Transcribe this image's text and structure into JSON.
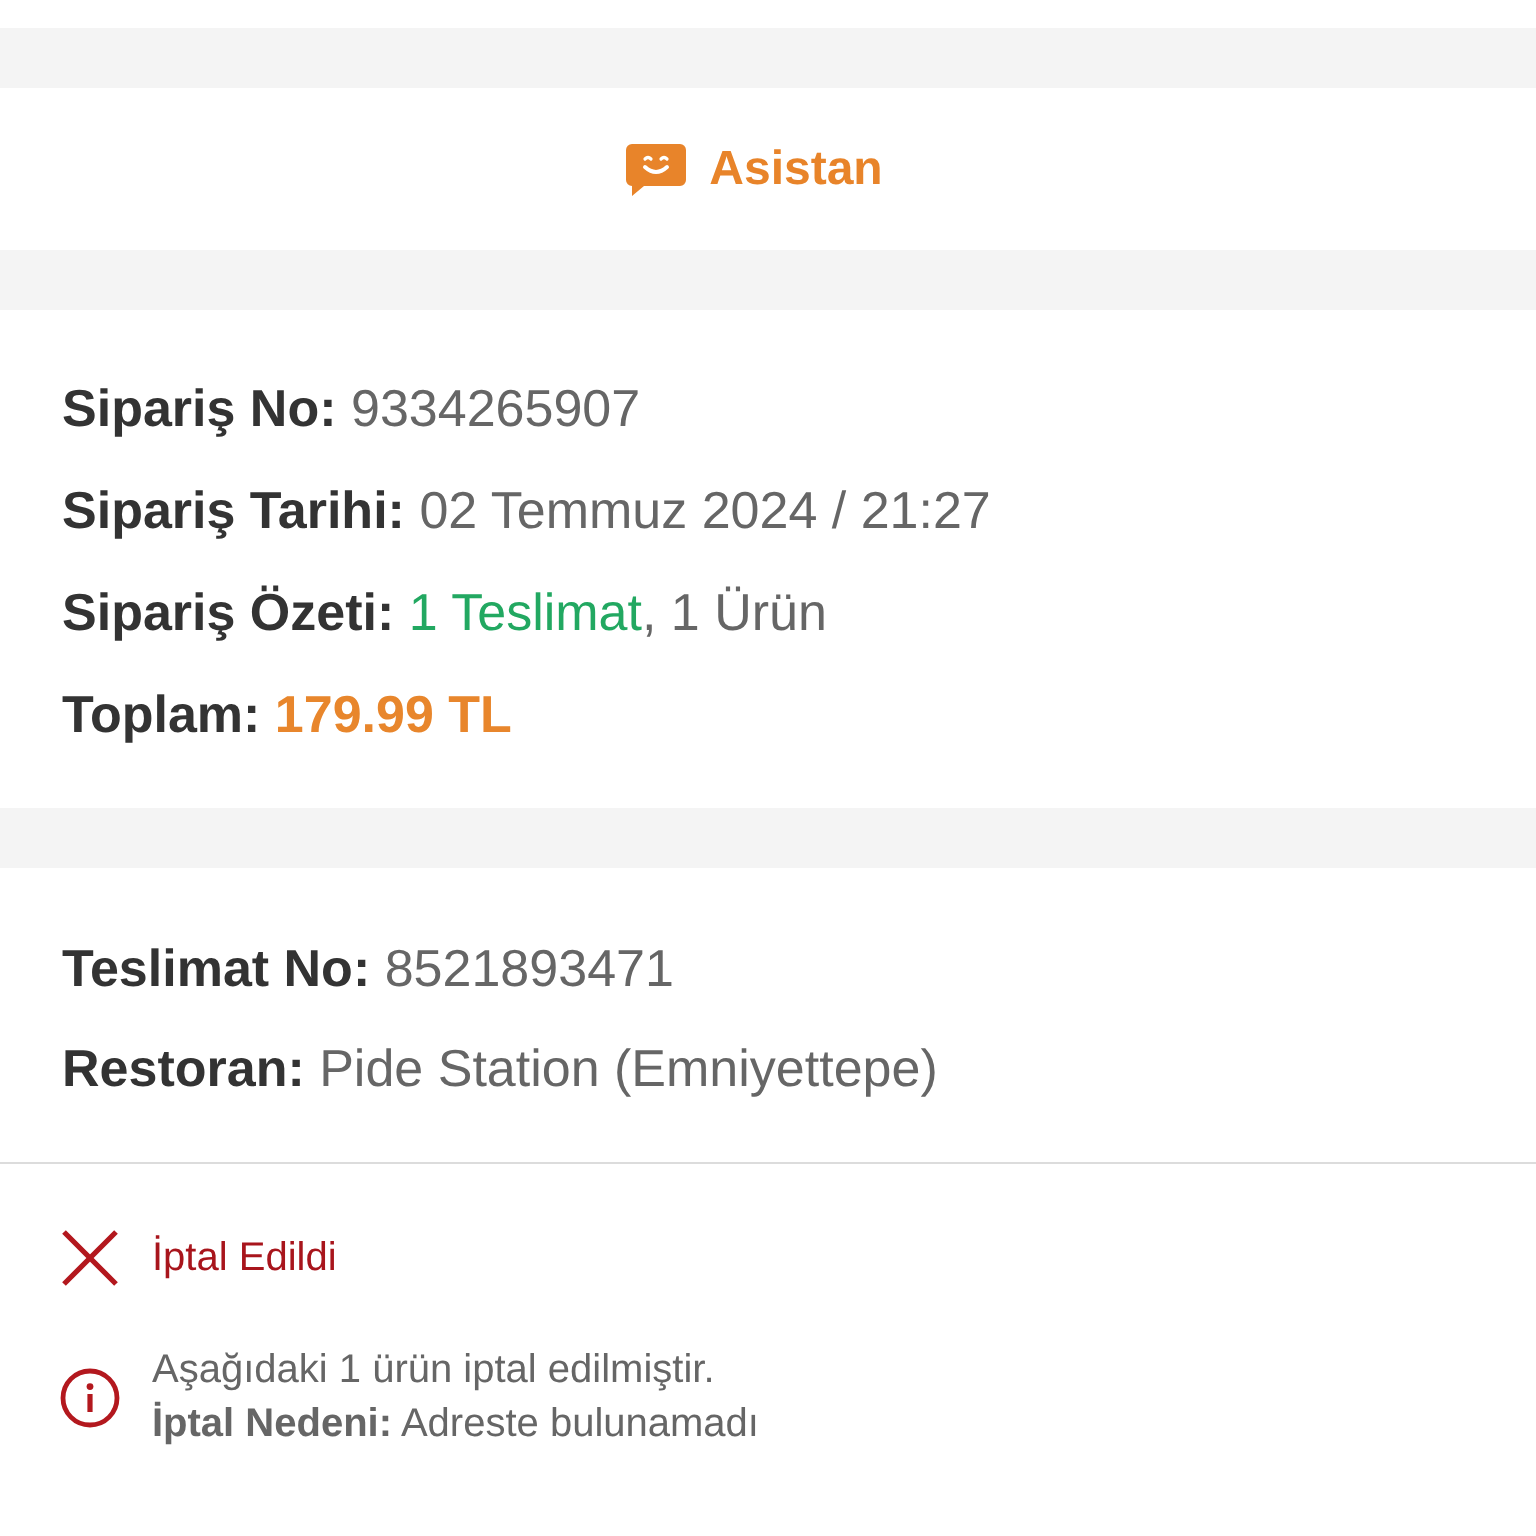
{
  "assistant_button": {
    "label": "Asistan"
  },
  "order": {
    "fields": [
      {
        "label": "Sipariş No:",
        "value": [
          {
            "text": "9334265907",
            "kind": "plain"
          }
        ]
      },
      {
        "label": "Sipariş Tarihi:",
        "value": [
          {
            "text": "02 Temmuz 2024 / 21:27",
            "kind": "plain"
          }
        ]
      },
      {
        "label": "Sipariş Özeti:",
        "value": [
          {
            "text": "1 Teslimat",
            "kind": "link"
          },
          {
            "text": ", 1 Ürün",
            "kind": "plain"
          }
        ]
      },
      {
        "label": "Toplam:",
        "value": [
          {
            "text": "179.99 TL",
            "kind": "price"
          }
        ]
      }
    ]
  },
  "delivery": {
    "fields": [
      {
        "label": "Teslimat No:",
        "value": [
          {
            "text": "8521893471",
            "kind": "plain"
          }
        ]
      },
      {
        "label": "Restoran:",
        "value": [
          {
            "text": "Pide Station (Emniyettepe)",
            "kind": "plain"
          }
        ]
      }
    ]
  },
  "status": {
    "kind": "cancelled",
    "label": "İptal Edildi"
  },
  "notice": {
    "kind": "info",
    "lines": [
      "Aşağıdaki 1 ürün iptal edilmiştir.",
      "**İptal Nedeni:** Adreste bulunamadı"
    ]
  }
}
